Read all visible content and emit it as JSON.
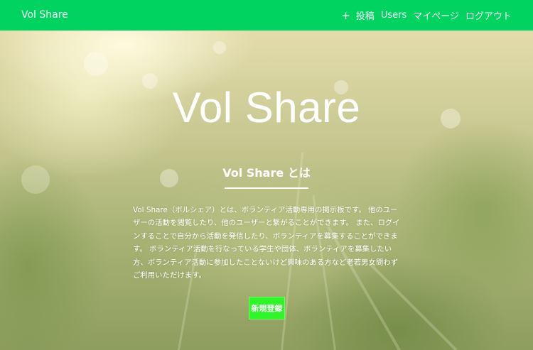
{
  "header": {
    "brand": "Vol Share",
    "nav": {
      "post_icon": "+",
      "post_label": "投稿",
      "users_label": "Users",
      "mypage_label": "マイページ",
      "logout_label": "ログアウト"
    }
  },
  "hero": {
    "title": "Vol Share",
    "about_heading": "Vol Share とは",
    "description": "Vol Share（ボルシェア）とは、ボランティア活動専用の掲示板です。 他のユーザーの活動を閲覧したり、他のユーザーと繋がることができます。 また、ログインすることで自分から活動を発信したり、ボランティアを募集することができます。 ボランティア活動を行なっている学生や団体、ボランティアを募集したい方、ボランティア活動に参加したことないけど興味のある方など老若男女問わずご利用いただけます。",
    "signup_label": "新規登録"
  },
  "colors": {
    "header_bg": "#00d35f",
    "signup_bg": "#2ff52a",
    "text": "#ffffff"
  }
}
